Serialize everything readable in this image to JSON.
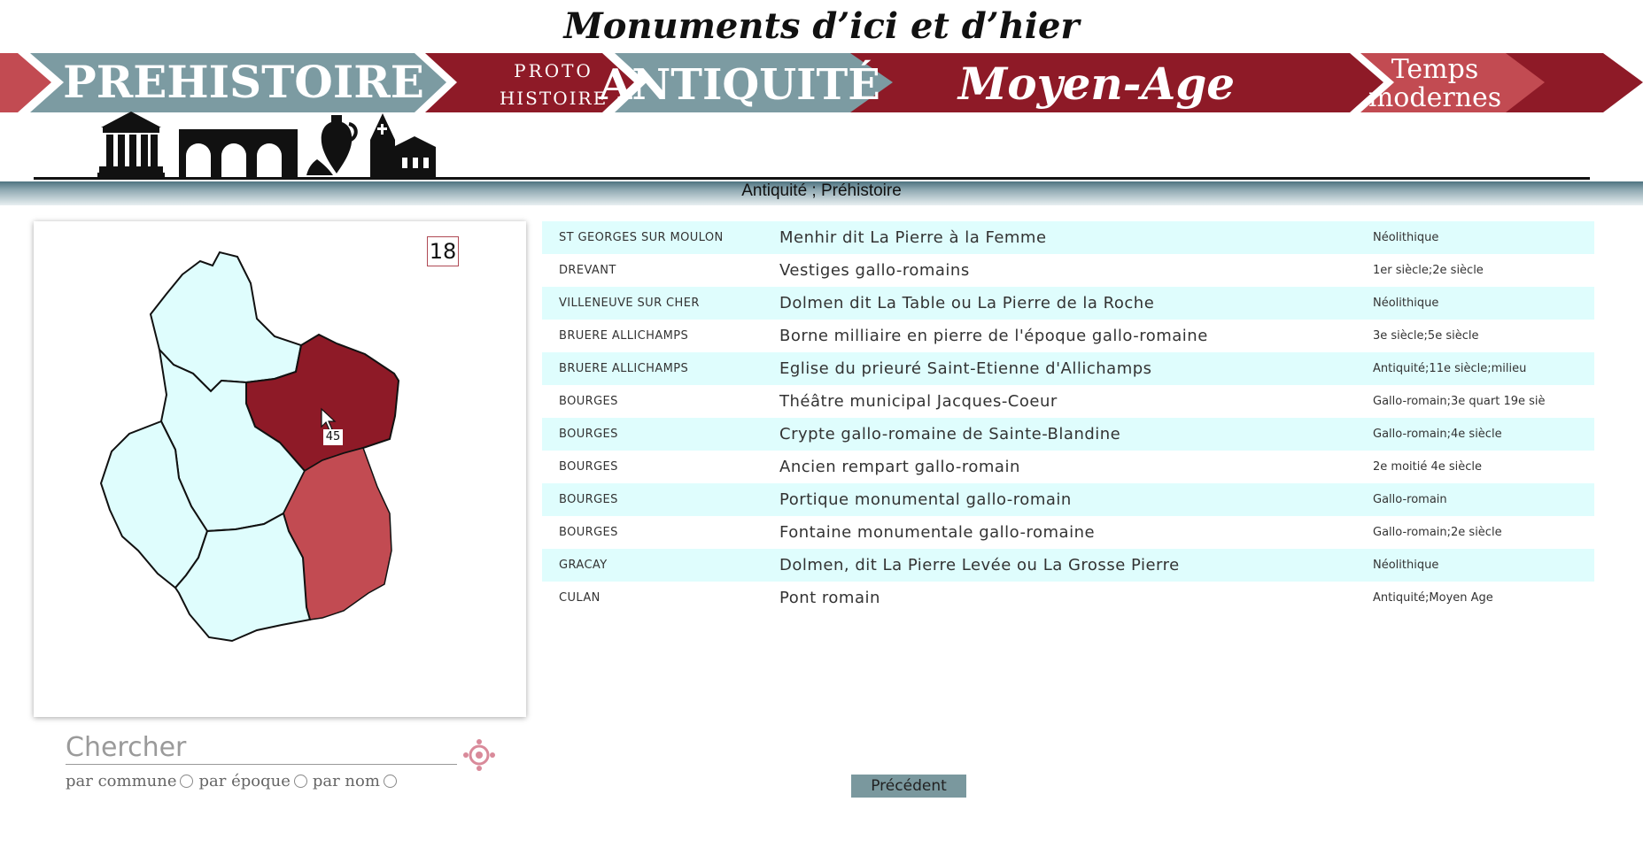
{
  "site_title": "Monuments d’ici et d’hier",
  "timeline": {
    "periods": [
      {
        "label": "PREHISTOIRE"
      },
      {
        "label_line1": "PROTO",
        "label_line2": "HISTOIRE"
      },
      {
        "label": "ANTIQUITÉ"
      },
      {
        "label": "Moyen-Age"
      },
      {
        "label_line1": "Temps",
        "label_line2": "modernes"
      }
    ],
    "colors": {
      "grey_blue": "#7c9ba2",
      "dark_red": "#8e1a27",
      "light_red": "#c24b52"
    }
  },
  "filter_label": "Antiquité ; Préhistoire",
  "map": {
    "department_badge": "18",
    "hover_count": "45",
    "colors": {
      "selected": "#8e1a27",
      "secondary": "#c24b52",
      "default": "#dffdfd"
    }
  },
  "results": [
    {
      "town": "ST GEORGES SUR MOULON",
      "name": "Menhir dit La Pierre à la Femme",
      "period": "Néolithique"
    },
    {
      "town": "DREVANT",
      "name": "Vestiges gallo-romains",
      "period": "1er siècle;2e siècle"
    },
    {
      "town": "VILLENEUVE SUR CHER",
      "name": "Dolmen dit La Table ou La Pierre de la Roche",
      "period": "Néolithique"
    },
    {
      "town": "BRUERE ALLICHAMPS",
      "name": "Borne milliaire en pierre de l'époque gallo-romaine",
      "period": "3e siècle;5e siècle"
    },
    {
      "town": "BRUERE ALLICHAMPS",
      "name": "Eglise du prieuré Saint-Etienne d'Allichamps",
      "period": "Antiquité;11e siècle;milieu"
    },
    {
      "town": "BOURGES",
      "name": "Théâtre municipal Jacques-Coeur",
      "period": "Gallo-romain;3e quart 19e siè"
    },
    {
      "town": "BOURGES",
      "name": "Crypte gallo-romaine de Sainte-Blandine",
      "period": "Gallo-romain;4e siècle"
    },
    {
      "town": "BOURGES",
      "name": "Ancien rempart gallo-romain",
      "period": "2e moitié 4e siècle"
    },
    {
      "town": "BOURGES",
      "name": "Portique monumental gallo-romain",
      "period": "Gallo-romain"
    },
    {
      "town": "BOURGES",
      "name": "Fontaine monumentale gallo-romaine",
      "period": "Gallo-romain;2e siècle"
    },
    {
      "town": "GRACAY",
      "name": "Dolmen, dit La Pierre Levée ou La Grosse Pierre",
      "period": "Néolithique"
    },
    {
      "town": "CULAN",
      "name": "Pont romain",
      "period": "Antiquité;Moyen Age"
    }
  ],
  "search": {
    "placeholder": "Chercher",
    "options": [
      "par commune",
      "par époque",
      "par nom"
    ]
  },
  "pagination": {
    "previous_label": "Précédent"
  }
}
